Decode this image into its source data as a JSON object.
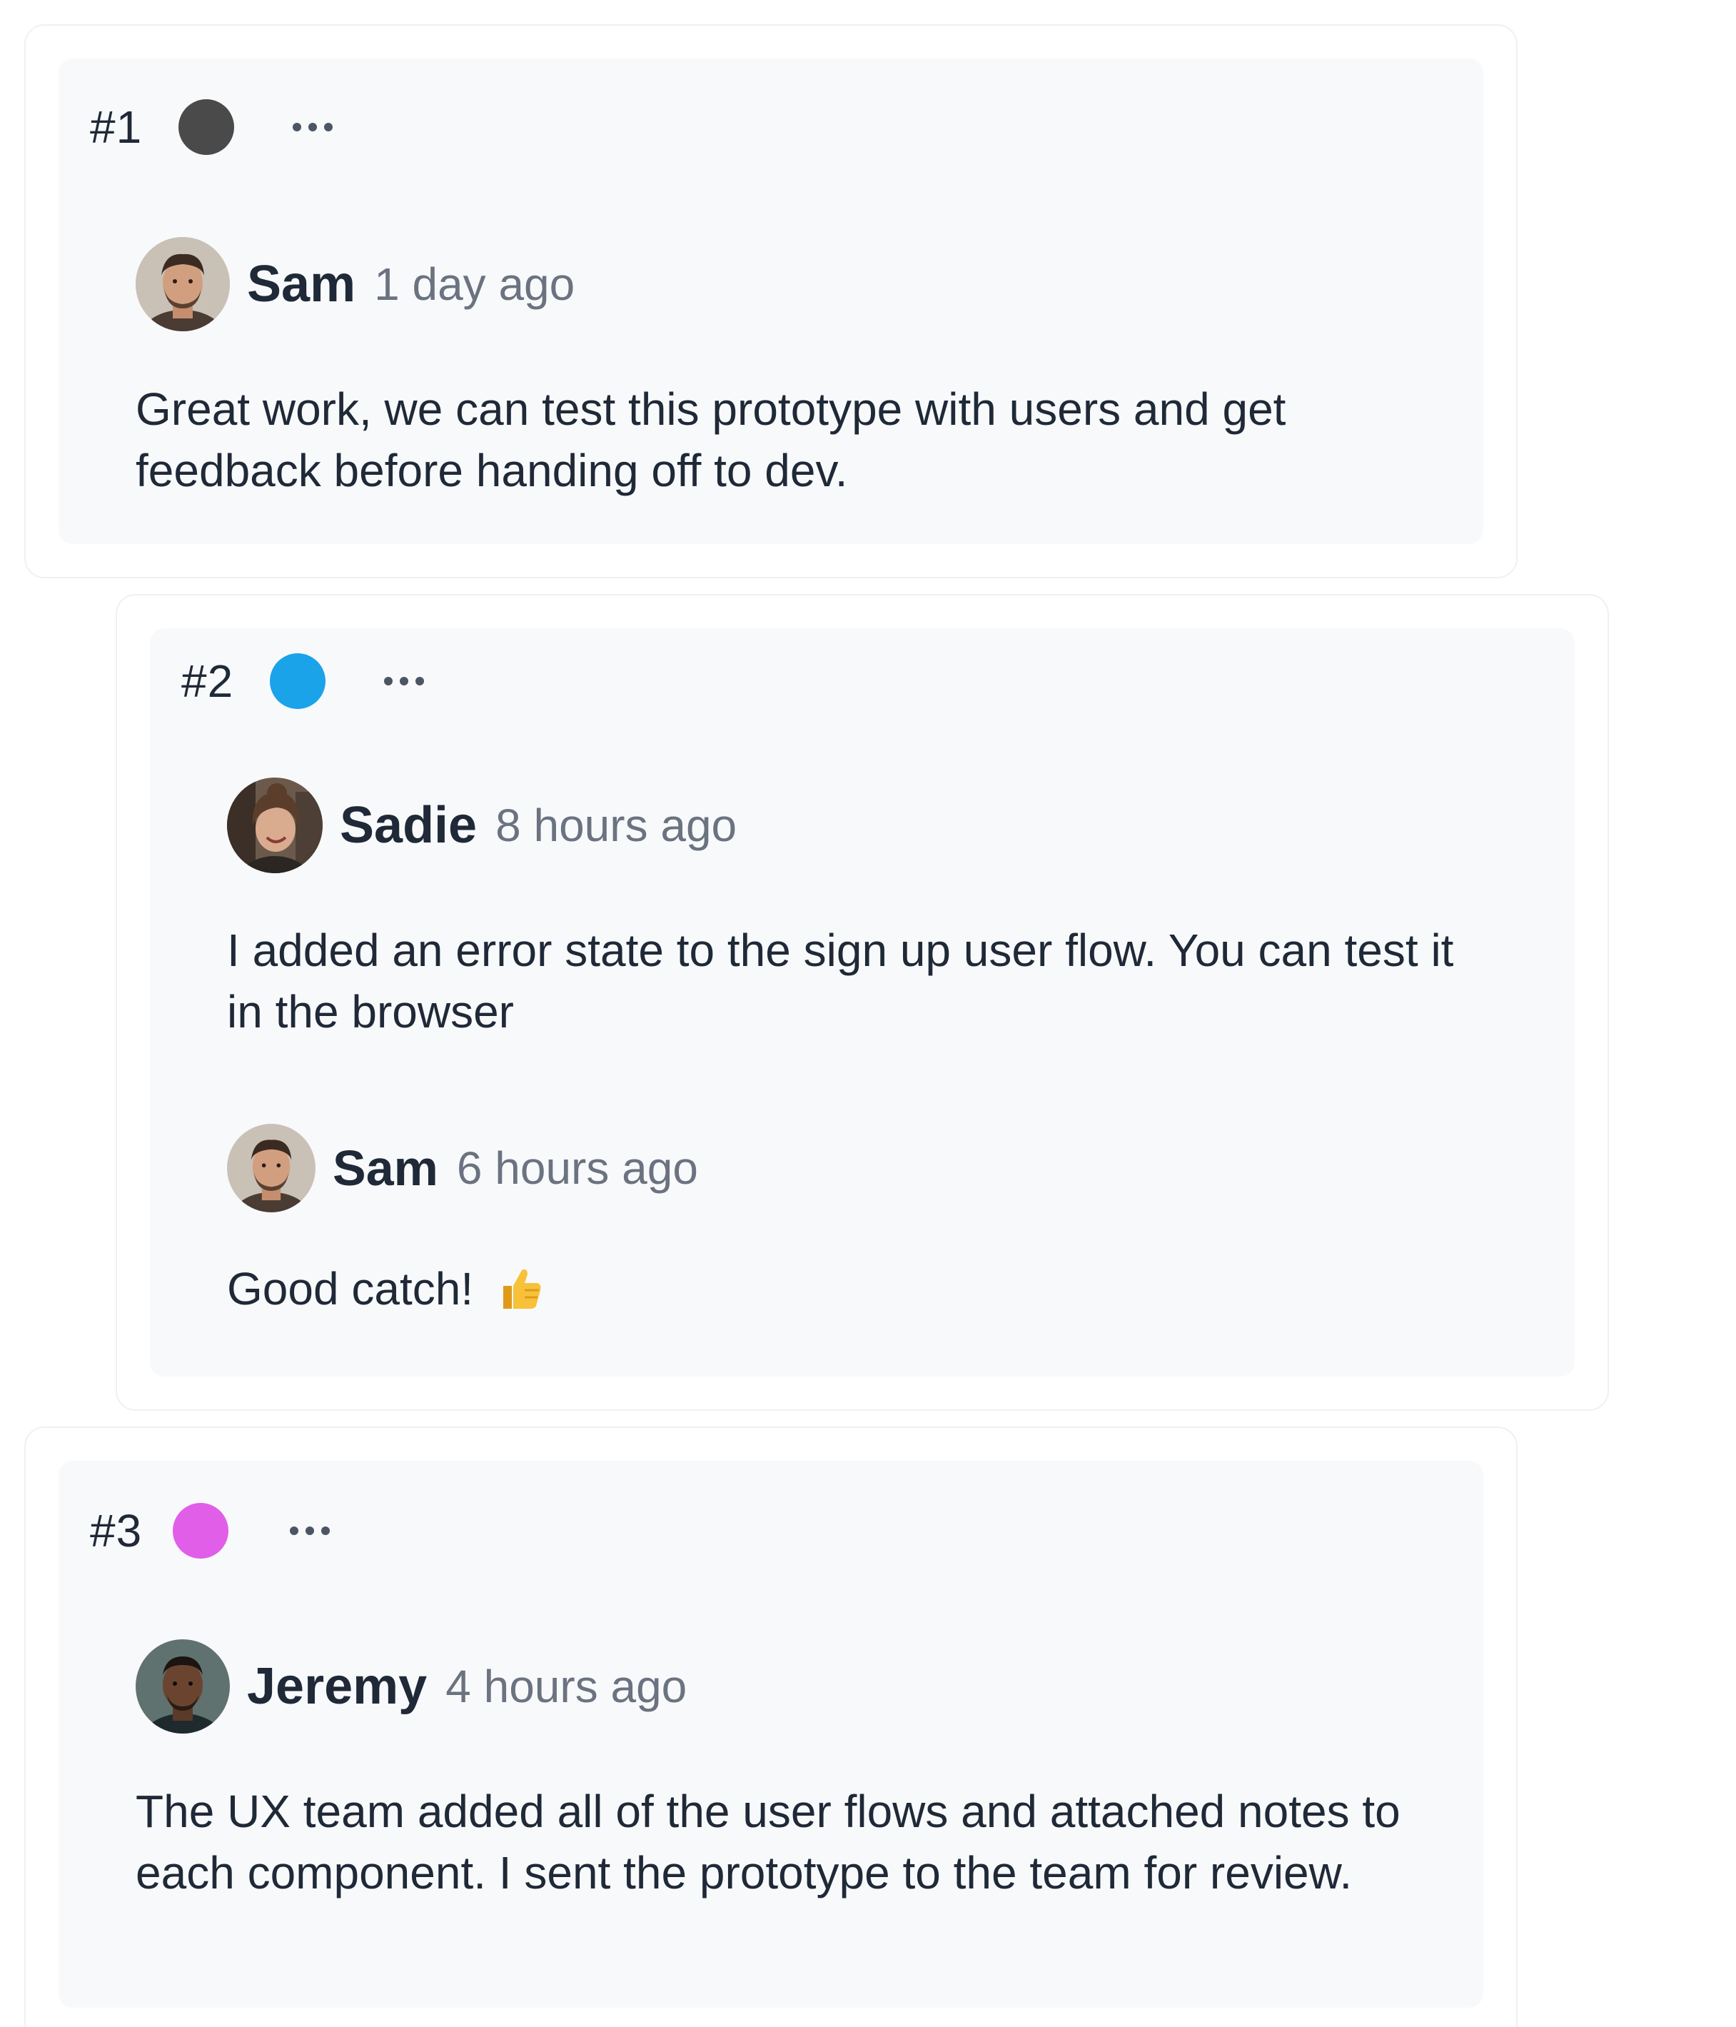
{
  "threads": [
    {
      "number": "#1",
      "dot_color": "#4a4a4a",
      "comments": [
        {
          "author": "Sam",
          "time": "1 day ago",
          "avatar": "sam-avatar",
          "body": "Great work, we can test this prototype with users and get feedback before handing off to dev."
        }
      ]
    },
    {
      "number": "#2",
      "dot_color": "#1aa3e8",
      "comments": [
        {
          "author": "Sadie",
          "time": "8 hours ago",
          "avatar": "sadie-avatar",
          "body": "I added an error state to the sign up user flow. You can test it in the browser"
        },
        {
          "author": "Sam",
          "time": "6 hours ago",
          "avatar": "sam-avatar",
          "body": "Good catch!",
          "emoji": "thumbs-up-emoji"
        }
      ]
    },
    {
      "number": "#3",
      "dot_color": "#e15ee8",
      "comments": [
        {
          "author": "Jeremy",
          "time": "4 hours ago",
          "avatar": "jeremy-avatar",
          "body": "The UX team added all of the user flows and attached notes to each component. I sent the prototype to the team for review."
        }
      ]
    }
  ],
  "icons": {
    "more": "more-horizontal-icon"
  }
}
